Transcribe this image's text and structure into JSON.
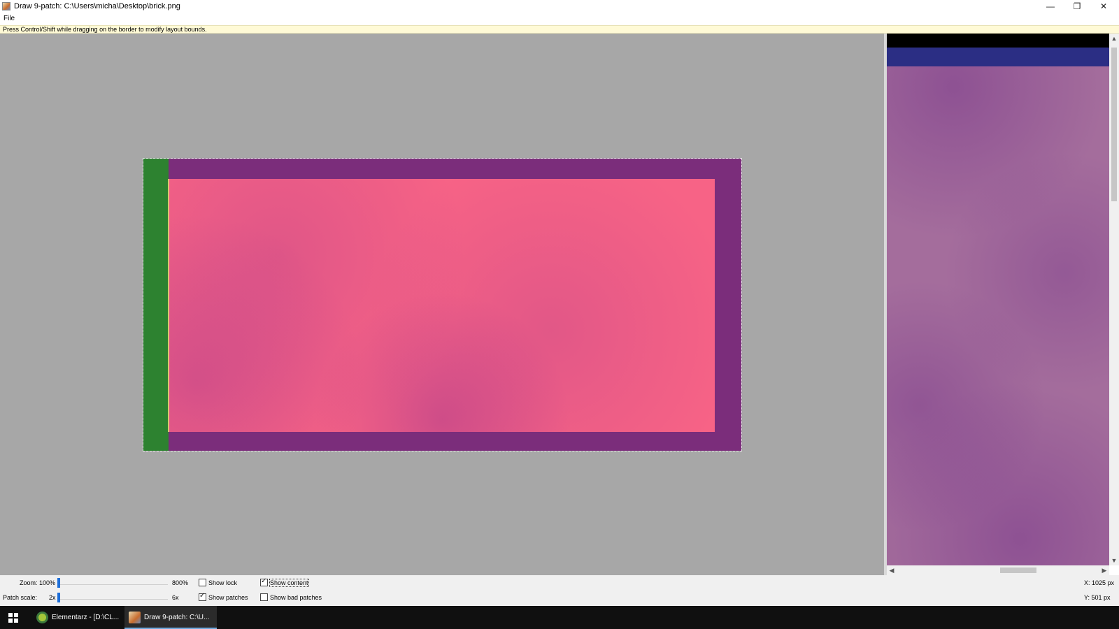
{
  "window": {
    "title": "Draw 9-patch: C:\\Users\\micha\\Desktop\\brick.png",
    "minimize_icon": "minimize-icon",
    "maximize_icon": "restore-icon",
    "close_icon": "close-icon"
  },
  "menu": {
    "file": "File"
  },
  "hint": "Press Control/Shift while dragging on the border to modify layout bounds.",
  "colors": {
    "editor_bg": "#a7a7a7",
    "patch_purple": "#7b2d7b",
    "patch_green": "#2d8230",
    "patch_pink": "#f76386",
    "preview_black": "#000000",
    "preview_blue": "#2b2e84",
    "preview_body": "#a46d9c",
    "accent_blue": "#1e6fd9"
  },
  "controls": {
    "zoom_label": "Zoom:",
    "zoom_value": "100%",
    "zoom_max": "800%",
    "patch_scale_label": "Patch scale:",
    "patch_scale_value": "2x",
    "patch_scale_max": "6x",
    "show_lock": {
      "label": "Show lock",
      "checked": false
    },
    "show_content": {
      "label": "Show content",
      "checked": true
    },
    "show_patches": {
      "label": "Show patches",
      "checked": true
    },
    "show_bad_patches": {
      "label": "Show bad patches",
      "checked": false
    }
  },
  "coords": {
    "x": "X:  1025 px",
    "y": "Y:    501 px"
  },
  "taskbar": {
    "start_icon": "windows-start-icon",
    "items": [
      {
        "label": "Elementarz - [D:\\CL...",
        "icon": "android-studio-icon",
        "active": false
      },
      {
        "label": "Draw 9-patch: C:\\U...",
        "icon": "java-icon",
        "active": true
      }
    ]
  }
}
